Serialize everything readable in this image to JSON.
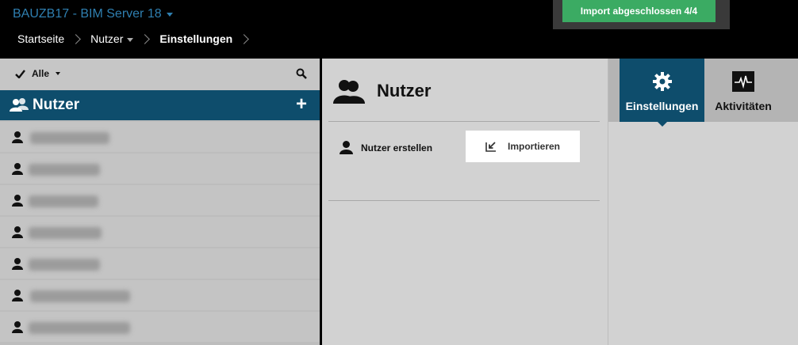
{
  "app": {
    "title": "BAUZB17 - BIM Server 18"
  },
  "breadcrumb": {
    "home": "Startseite",
    "users": "Nutzer",
    "current": "Einstellungen"
  },
  "notification": {
    "text": "Import abgeschlossen 4/4"
  },
  "sidebar": {
    "filter_label": "Alle",
    "header_title": "Nutzer",
    "add_label": "+",
    "rows_count_visible": 7
  },
  "main": {
    "title": "Nutzer",
    "create_user_label": "Nutzer erstellen",
    "import_label": "Importieren"
  },
  "tabs": {
    "settings_label": "Einstellungen",
    "activity_label": "Aktivitäten"
  },
  "colors": {
    "accent": "#0e4d6c",
    "title": "#2f7fb0",
    "success": "#3bab63"
  }
}
